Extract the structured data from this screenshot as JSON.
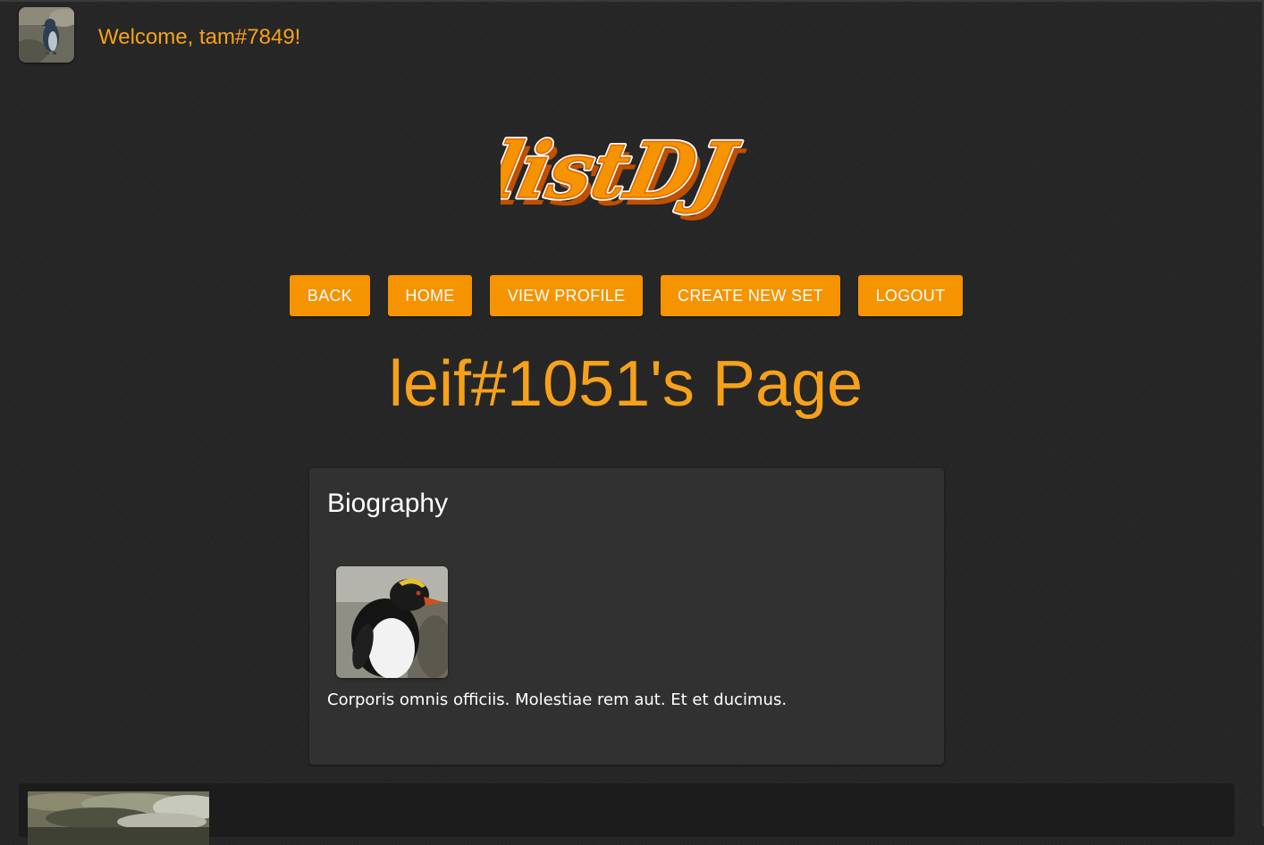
{
  "header": {
    "welcome_text": "Welcome, tam#7849!",
    "avatar_icon": "user-avatar-penguin"
  },
  "logo": {
    "text": "listDJ"
  },
  "nav": {
    "back_label": "BACK",
    "home_label": "HOME",
    "view_profile_label": "VIEW PROFILE",
    "create_new_set_label": "CREATE NEW SET",
    "logout_label": "LOGOUT"
  },
  "page": {
    "title": "leif#1051's Page"
  },
  "biography": {
    "heading": "Biography",
    "text": "Corporis omnis officiis. Molestiae rem aut. Et et ducimus.",
    "image_icon": "profile-photo-penguin"
  },
  "sets": {
    "thumbnail_icon": "set-thumbnail-rocks"
  },
  "colors": {
    "accent": "#f59300",
    "title_orange": "#f7a11a",
    "background": "#262626",
    "card": "#313131"
  }
}
